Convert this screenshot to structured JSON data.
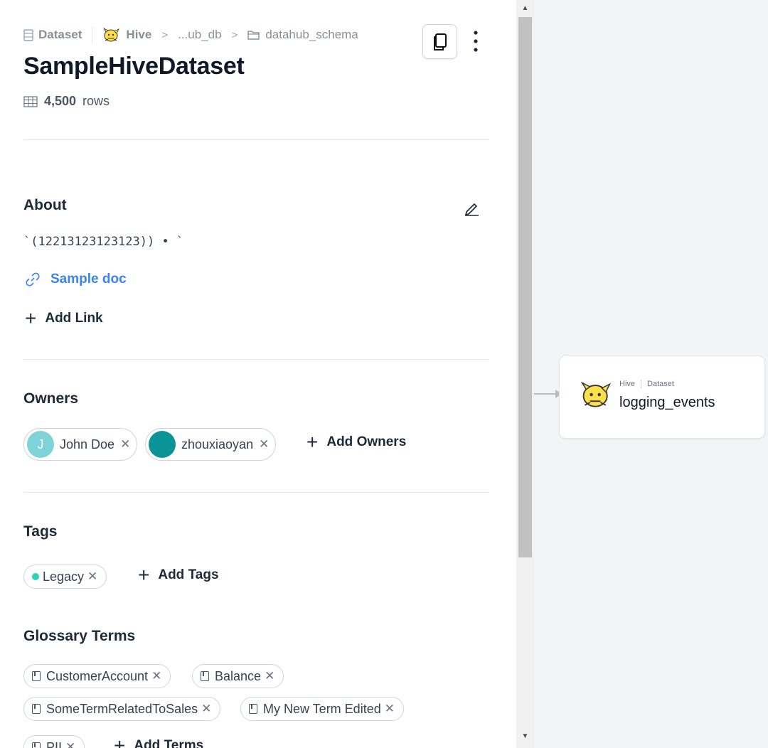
{
  "breadcrumb": {
    "type_label": "Dataset",
    "platform_label": "Hive",
    "db_label": "...ub_db",
    "schema_label": "datahub_schema"
  },
  "entity": {
    "title": "SampleHiveDataset",
    "row_count": "4,500",
    "rows_unit": "rows"
  },
  "about": {
    "heading": "About",
    "text": "`(12213123123123)) • `",
    "link_label": "Sample doc",
    "add_link_label": "Add Link"
  },
  "owners": {
    "heading": "Owners",
    "items": [
      {
        "initial": "J",
        "name": "John Doe",
        "avatar_color": "#7dd3d8"
      },
      {
        "initial": "",
        "name": "zhouxiaoyan",
        "avatar_color": "#0b9497"
      }
    ],
    "add_label": "Add Owners"
  },
  "tags": {
    "heading": "Tags",
    "items": [
      {
        "name": "Legacy",
        "color": "#2ed1b8"
      }
    ],
    "add_label": "Add Tags"
  },
  "glossary": {
    "heading": "Glossary Terms",
    "items": [
      {
        "name": "CustomerAccount"
      },
      {
        "name": "Balance"
      },
      {
        "name": "SomeTermRelatedToSales"
      },
      {
        "name": "My New Term Edited"
      },
      {
        "name": "PII"
      }
    ],
    "add_label": "Add Terms"
  },
  "lineage": {
    "node": {
      "platform": "Hive",
      "type": "Dataset",
      "name": "logging_events"
    }
  },
  "colors": {
    "link_blue": "#3b82f6",
    "hive_yellow": "#fde047"
  }
}
